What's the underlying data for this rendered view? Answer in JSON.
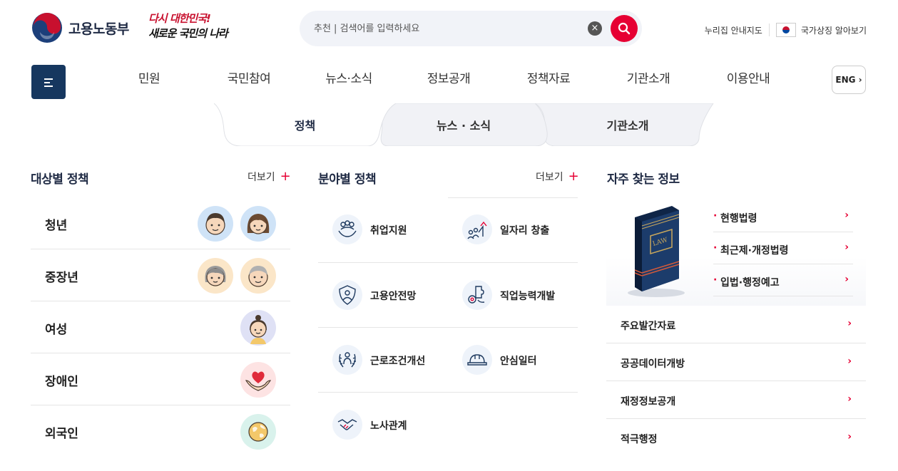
{
  "header": {
    "logo_text": "고용노동부",
    "slogan_line1": "다시 대한민국!",
    "slogan_line2": "새로운 국민의 나라",
    "search_placeholder": "추천 | 검색어를 입력하세요",
    "clear_icon": "close-icon",
    "search_icon": "search-icon",
    "util_links": [
      "누리집 안내지도",
      "국가상징 알아보기"
    ],
    "accent_color": "#e60033",
    "brand_color": "#16375f"
  },
  "gnb": {
    "menu_icon": "hamburger-icon",
    "items": [
      "민원",
      "국민참여",
      "뉴스·소식",
      "정보공개",
      "정책자료",
      "기관소개",
      "이용안내"
    ],
    "eng_label": "ENG",
    "eng_icon": "chevron-right-icon"
  },
  "tabs": [
    {
      "label": "정책",
      "active": true
    },
    {
      "label": "뉴스 · 소식",
      "active": false
    },
    {
      "label": "기관소개",
      "active": false
    }
  ],
  "target_policy": {
    "title": "대상별 정책",
    "more_label": "더보기",
    "more_icon": "plus-icon",
    "items": [
      {
        "label": "청년",
        "icons": [
          "young-man-avatar-icon",
          "young-woman-avatar-icon"
        ]
      },
      {
        "label": "중장년",
        "icons": [
          "older-woman-avatar-icon",
          "older-man-avatar-icon"
        ]
      },
      {
        "label": "여성",
        "icons": [
          "woman-avatar-icon"
        ]
      },
      {
        "label": "장애인",
        "icons": [
          "heart-hands-icon"
        ]
      },
      {
        "label": "외국인",
        "icons": [
          "globe-icon"
        ]
      }
    ]
  },
  "field_policy": {
    "title": "분야별 정책",
    "more_label": "더보기",
    "more_icon": "plus-icon",
    "items": [
      {
        "label": "취업지원",
        "icon": "people-hands-icon"
      },
      {
        "label": "일자리 창출",
        "icon": "growth-people-icon"
      },
      {
        "label": "고용안전망",
        "icon": "shield-person-icon"
      },
      {
        "label": "직업능력개발",
        "icon": "puzzle-gear-icon"
      },
      {
        "label": "근로조건개선",
        "icon": "laurel-person-icon"
      },
      {
        "label": "안심일터",
        "icon": "hard-hat-icon"
      },
      {
        "label": "노사관계",
        "icon": "handshake-icon"
      }
    ]
  },
  "frequent_info": {
    "title": "자주 찾는 정보",
    "book_label": "LAW",
    "book_icon": "law-book-icon",
    "law_links": [
      "현행법령",
      "최근제·개정법령",
      "입법·행정예고"
    ],
    "list": [
      "주요발간자료",
      "공공데이터개방",
      "재정정보공개",
      "적극행정"
    ],
    "arrow_icon": "chevron-right-icon"
  }
}
